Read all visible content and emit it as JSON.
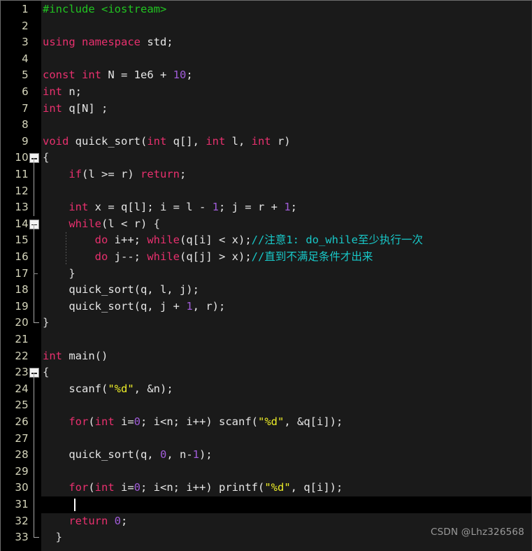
{
  "editor": {
    "name": "code-editor",
    "language": "C++",
    "background": "#1a1a1a",
    "gutter_background": "#000000",
    "line_number_color": "#d6d6bc",
    "active_line": 31,
    "total_lines": 33,
    "cursor": {
      "line": 31,
      "column": 5
    },
    "colors": {
      "keyword": "#e8306e",
      "preprocessor": "#21c421",
      "header": "#21c421",
      "number": "#a05cd8",
      "string": "#ecec28",
      "comment": "#18c8c8",
      "plain": "#e6e6e6"
    }
  },
  "watermark": {
    "text": "CSDN @Lhz326568"
  },
  "fold_markers": {
    "open_boxes": [
      10,
      14,
      23
    ],
    "guide_lines": [
      11,
      12,
      13,
      15,
      16,
      18,
      19,
      24,
      25,
      26,
      27,
      28,
      29,
      30,
      31,
      32
    ],
    "end_corners": [
      20,
      33
    ],
    "ticks": [
      17
    ]
  },
  "lines": [
    {
      "n": 1,
      "text": "#include <iostream>"
    },
    {
      "n": 2,
      "text": ""
    },
    {
      "n": 3,
      "text": "using namespace std;"
    },
    {
      "n": 4,
      "text": ""
    },
    {
      "n": 5,
      "text": "const int N = 1e6 + 10;"
    },
    {
      "n": 6,
      "text": "int n;"
    },
    {
      "n": 7,
      "text": "int q[N] ;"
    },
    {
      "n": 8,
      "text": ""
    },
    {
      "n": 9,
      "text": "void quick_sort(int q[], int l, int r)"
    },
    {
      "n": 10,
      "text": "{"
    },
    {
      "n": 11,
      "text": "    if(l >= r) return;"
    },
    {
      "n": 12,
      "text": ""
    },
    {
      "n": 13,
      "text": "    int x = q[l]; i = l - 1; j = r + 1;"
    },
    {
      "n": 14,
      "text": "    while(l < r) {"
    },
    {
      "n": 15,
      "text": "        do i++; while(q[i] < x);//注意1: do_while至少执行一次"
    },
    {
      "n": 16,
      "text": "        do j--; while(q[j] > x);//直到不满足条件才出来"
    },
    {
      "n": 17,
      "text": "    }"
    },
    {
      "n": 18,
      "text": "    quick_sort(q, l, j);"
    },
    {
      "n": 19,
      "text": "    quick_sort(q, j + 1, r);"
    },
    {
      "n": 20,
      "text": "}"
    },
    {
      "n": 21,
      "text": ""
    },
    {
      "n": 22,
      "text": "int main()"
    },
    {
      "n": 23,
      "text": "{"
    },
    {
      "n": 24,
      "text": "    scanf(\"%d\", &n);"
    },
    {
      "n": 25,
      "text": ""
    },
    {
      "n": 26,
      "text": "    for(int i=0; i<n; i++) scanf(\"%d\", &q[i]);"
    },
    {
      "n": 27,
      "text": ""
    },
    {
      "n": 28,
      "text": "    quick_sort(q, 0, n-1);"
    },
    {
      "n": 29,
      "text": ""
    },
    {
      "n": 30,
      "text": "    for(int i=0; i<n; i++) printf(\"%d\", q[i]);"
    },
    {
      "n": 31,
      "text": "    "
    },
    {
      "n": 32,
      "text": "    return 0;"
    },
    {
      "n": 33,
      "text": "  }"
    }
  ],
  "rendered": {
    "1": [
      [
        "pp",
        "#include"
      ],
      [
        "pl",
        " "
      ],
      [
        "hdr",
        "<iostream>"
      ]
    ],
    "3": [
      [
        "kw",
        "using namespace"
      ],
      [
        "pl",
        " std;"
      ]
    ],
    "5": [
      [
        "kw",
        "const int"
      ],
      [
        "pl",
        " N = 1e6 + "
      ],
      [
        "num",
        "10"
      ],
      [
        "pl",
        ";"
      ]
    ],
    "6": [
      [
        "kw",
        "int"
      ],
      [
        "pl",
        " n;"
      ]
    ],
    "7": [
      [
        "kw",
        "int"
      ],
      [
        "pl",
        " q[N] ;"
      ]
    ],
    "9": [
      [
        "kw",
        "void"
      ],
      [
        "pl",
        " quick_sort("
      ],
      [
        "kw",
        "int"
      ],
      [
        "pl",
        " q[], "
      ],
      [
        "kw",
        "int"
      ],
      [
        "pl",
        " l, "
      ],
      [
        "kw",
        "int"
      ],
      [
        "pl",
        " r)"
      ]
    ],
    "10": [
      [
        "br",
        "{"
      ]
    ],
    "11": [
      [
        "pl",
        "    "
      ],
      [
        "kw",
        "if"
      ],
      [
        "pl",
        "(l >= r) "
      ],
      [
        "kw",
        "return"
      ],
      [
        "pl",
        ";"
      ]
    ],
    "13": [
      [
        "pl",
        "    "
      ],
      [
        "kw",
        "int"
      ],
      [
        "pl",
        " x = q[l]; i = l - "
      ],
      [
        "num",
        "1"
      ],
      [
        "pl",
        "; j = r + "
      ],
      [
        "num",
        "1"
      ],
      [
        "pl",
        ";"
      ]
    ],
    "14": [
      [
        "pl",
        "    "
      ],
      [
        "kw",
        "while"
      ],
      [
        "pl",
        "(l < r) "
      ],
      [
        "br",
        "{"
      ]
    ],
    "15": [
      [
        "pl",
        "        "
      ],
      [
        "kw",
        "do"
      ],
      [
        "pl",
        " i++; "
      ],
      [
        "kw",
        "while"
      ],
      [
        "pl",
        "(q[i] < x);"
      ],
      [
        "cmt",
        "//注意1: do_while至少执行一次"
      ]
    ],
    "16": [
      [
        "pl",
        "        "
      ],
      [
        "kw",
        "do"
      ],
      [
        "pl",
        " j--; "
      ],
      [
        "kw",
        "while"
      ],
      [
        "pl",
        "(q[j] > x);"
      ],
      [
        "cmt",
        "//直到不满足条件才出来"
      ]
    ],
    "17": [
      [
        "pl",
        "    "
      ],
      [
        "br",
        "}"
      ]
    ],
    "18": [
      [
        "pl",
        "    quick_sort(q, l, j);"
      ]
    ],
    "19": [
      [
        "pl",
        "    quick_sort(q, j + "
      ],
      [
        "num",
        "1"
      ],
      [
        "pl",
        ", r);"
      ]
    ],
    "20": [
      [
        "br",
        "}"
      ]
    ],
    "22": [
      [
        "kw",
        "int"
      ],
      [
        "pl",
        " main()"
      ]
    ],
    "23": [
      [
        "br",
        "{"
      ]
    ],
    "24": [
      [
        "pl",
        "    scanf("
      ],
      [
        "str",
        "\"%d\""
      ],
      [
        "pl",
        ", &n);"
      ]
    ],
    "26": [
      [
        "pl",
        "    "
      ],
      [
        "kw",
        "for"
      ],
      [
        "pl",
        "("
      ],
      [
        "kw",
        "int"
      ],
      [
        "pl",
        " i="
      ],
      [
        "num",
        "0"
      ],
      [
        "pl",
        "; i<n; i++) scanf("
      ],
      [
        "str",
        "\"%d\""
      ],
      [
        "pl",
        ", &q[i]);"
      ]
    ],
    "28": [
      [
        "pl",
        "    quick_sort(q, "
      ],
      [
        "num",
        "0"
      ],
      [
        "pl",
        ", n-"
      ],
      [
        "num",
        "1"
      ],
      [
        "pl",
        ");"
      ]
    ],
    "30": [
      [
        "pl",
        "    "
      ],
      [
        "kw",
        "for"
      ],
      [
        "pl",
        "("
      ],
      [
        "kw",
        "int"
      ],
      [
        "pl",
        " i="
      ],
      [
        "num",
        "0"
      ],
      [
        "pl",
        "; i<n; i++) printf("
      ],
      [
        "str",
        "\"%d\""
      ],
      [
        "pl",
        ", q[i]);"
      ]
    ],
    "31": [
      [
        "pl",
        ""
      ]
    ],
    "32": [
      [
        "pl",
        "    "
      ],
      [
        "kw",
        "return"
      ],
      [
        "pl",
        " "
      ],
      [
        "num",
        "0"
      ],
      [
        "pl",
        ";"
      ]
    ],
    "33": [
      [
        "pl",
        "  "
      ],
      [
        "br",
        "}"
      ]
    ]
  }
}
